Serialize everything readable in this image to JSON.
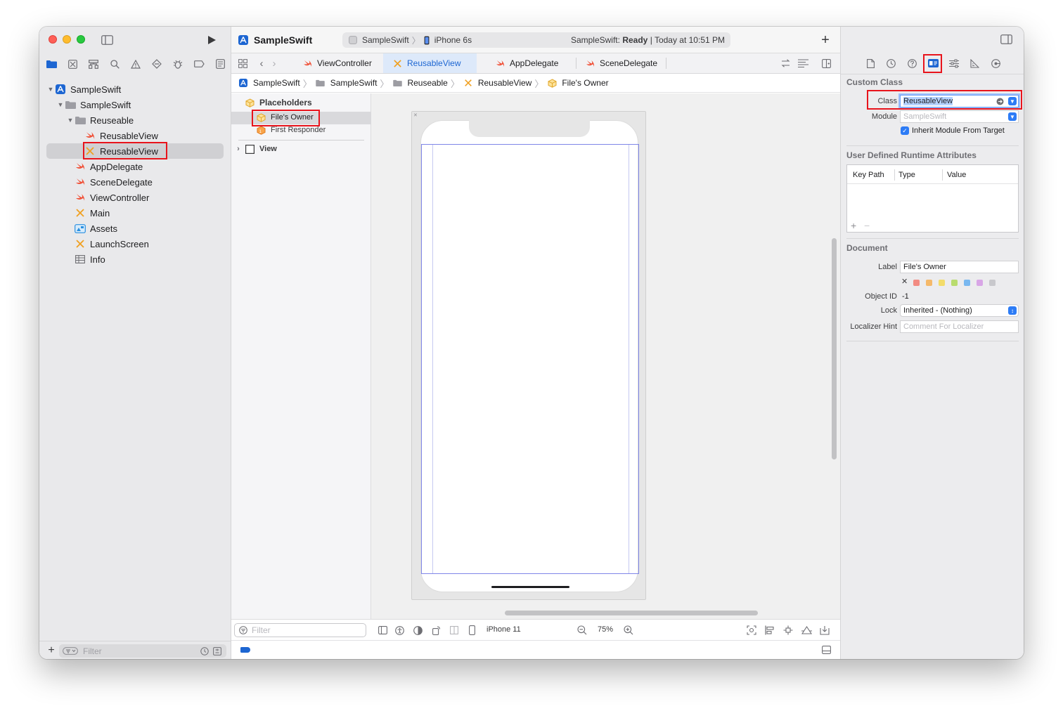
{
  "window": {
    "project_name": "SampleSwift",
    "scheme_name": "SampleSwift",
    "device_name": "iPhone 6s",
    "status_project": "SampleSwift:",
    "status_state": "Ready",
    "status_time": "| Today at 10:51 PM"
  },
  "navigator": {
    "items": [
      {
        "label": "SampleSwift",
        "icon": "project-icon"
      },
      {
        "label": "SampleSwift",
        "icon": "folder-icon"
      },
      {
        "label": "Reuseable",
        "icon": "folder-icon"
      },
      {
        "label": "ReusableView",
        "icon": "swift-file-icon"
      },
      {
        "label": "ReusableView",
        "icon": "xib-file-icon"
      },
      {
        "label": "AppDelegate",
        "icon": "swift-file-icon"
      },
      {
        "label": "SceneDelegate",
        "icon": "swift-file-icon"
      },
      {
        "label": "ViewController",
        "icon": "swift-file-icon"
      },
      {
        "label": "Main",
        "icon": "storyboard-icon"
      },
      {
        "label": "Assets",
        "icon": "asset-catalog-icon"
      },
      {
        "label": "LaunchScreen",
        "icon": "storyboard-icon"
      },
      {
        "label": "Info",
        "icon": "plist-icon"
      }
    ],
    "filter_placeholder": "Filter"
  },
  "tabs": [
    {
      "label": "ViewController"
    },
    {
      "label": "ReusableView"
    },
    {
      "label": "AppDelegate"
    },
    {
      "label": "SceneDelegate"
    }
  ],
  "breadcrumb": [
    "SampleSwift",
    "SampleSwift",
    "Reuseable",
    "ReusableView",
    "File's Owner"
  ],
  "outline": {
    "section": "Placeholders",
    "files_owner": "File's Owner",
    "first_responder": "First Responder",
    "view": "View",
    "filter_placeholder": "Filter"
  },
  "bottom_bar": {
    "device": "iPhone 11",
    "zoom": "75%"
  },
  "inspector": {
    "custom_class_title": "Custom Class",
    "class_label": "Class",
    "class_value": "ReusableView",
    "module_label": "Module",
    "module_placeholder": "SampleSwift",
    "inherit_label": "Inherit Module From Target",
    "inherit_checked": true,
    "runtime_title": "User Defined Runtime Attributes",
    "col_keypath": "Key Path",
    "col_type": "Type",
    "col_value": "Value",
    "document_title": "Document",
    "label_label": "Label",
    "label_value": "File's Owner",
    "object_id_label": "Object ID",
    "object_id_value": "-1",
    "lock_label": "Lock",
    "lock_value": "Inherited - (Nothing)",
    "localizer_label": "Localizer Hint",
    "localizer_placeholder": "Comment For Localizer",
    "swatch_colors": [
      "#f28b82",
      "#f5b96a",
      "#f3dc6a",
      "#b9dc6e",
      "#79b8f0",
      "#d8a6e6",
      "#c8c8cc"
    ]
  },
  "colors": {
    "accent": "#1d66d2",
    "highlight": "#e8141c",
    "swift": "#f05138",
    "xib": "#f0a020"
  }
}
